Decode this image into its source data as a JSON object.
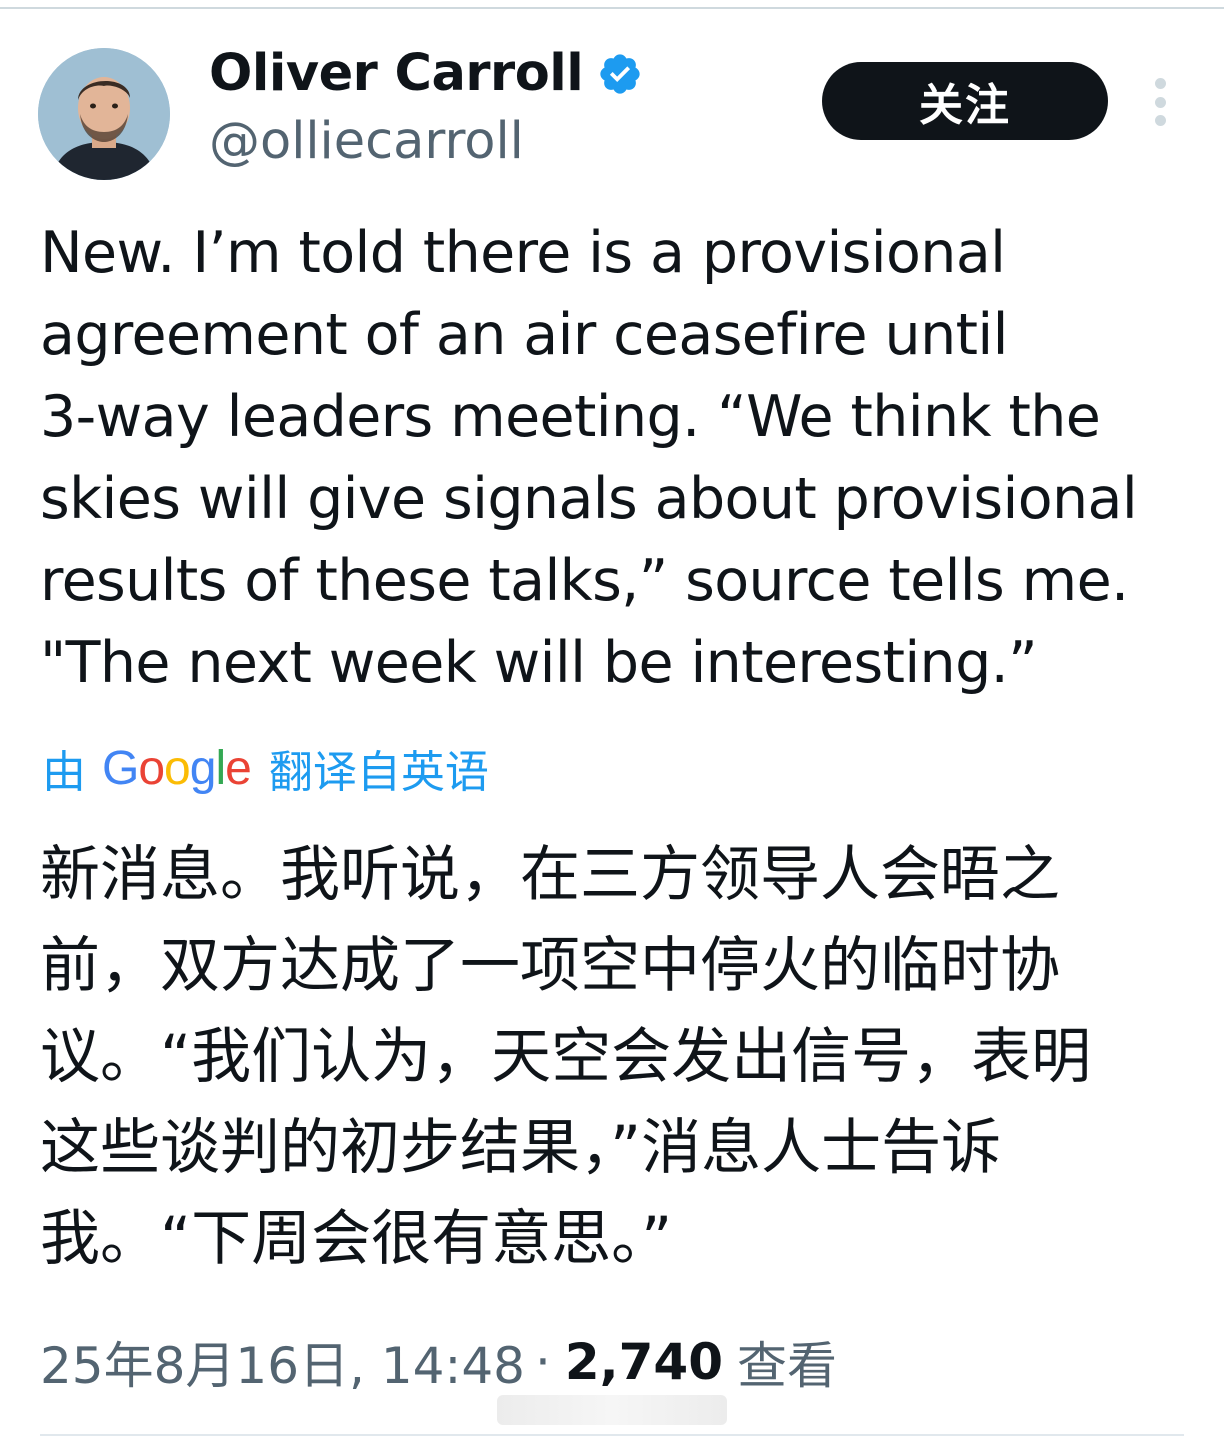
{
  "author": {
    "name": "Oliver Carroll",
    "handle": "@olliecarroll",
    "verified_icon": "verified-badge-icon",
    "avatar_icon": "profile-photo"
  },
  "header": {
    "follow_label": "关注",
    "more_icon": "more-vertical-icon"
  },
  "tweet": {
    "text": "New. I’m told there is a provisional\nagreement of an air ceasefire until\n3-way leaders meeting. “We think the\nskies will give signals about provisional\nresults of these talks,” source tells me.\n\"The next week will be interesting.”"
  },
  "translation": {
    "prefix": "由",
    "provider": "Google",
    "suffix": "翻译自英语",
    "text": "新消息。我听说，在三方领导人会晤之\n前，双方达成了一项空中停火的临时协\n议。“我们认为，天空会发出信号，表明\n这些谈判的初步结果，”消息人士告诉\n我。“下周会很有意思。”"
  },
  "meta": {
    "date": "25年8月16日, 14:48",
    "separator": "·",
    "views": "2,740",
    "views_label": "查看"
  },
  "colors": {
    "accent": "#1d9bf0",
    "text": "#0f1419",
    "secondary": "#536471",
    "button_bg": "#0f1419"
  }
}
